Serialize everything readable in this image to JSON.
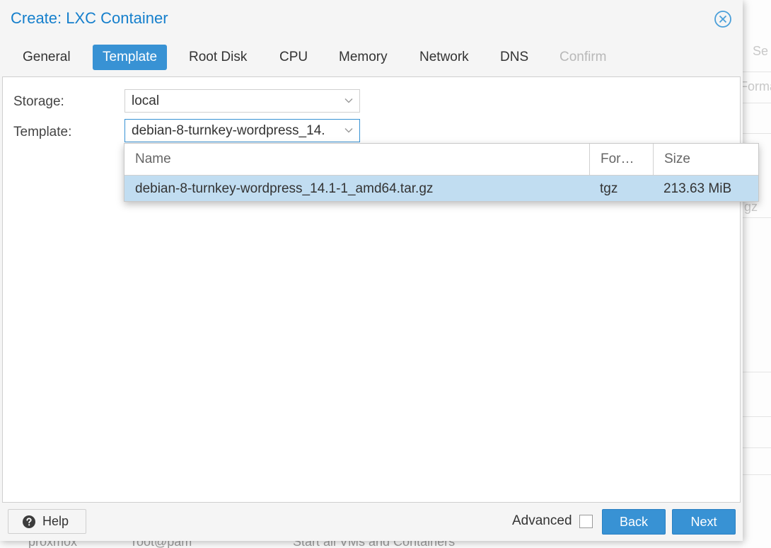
{
  "background": {
    "fragments": [
      "Se",
      "Forma",
      "gz"
    ],
    "bottom": [
      "proxmox",
      "root@pam",
      "Start all VMs and Containers"
    ]
  },
  "dialog": {
    "title": "Create: LXC Container",
    "tabs": [
      {
        "label": "General",
        "state": "normal"
      },
      {
        "label": "Template",
        "state": "active"
      },
      {
        "label": "Root Disk",
        "state": "normal"
      },
      {
        "label": "CPU",
        "state": "normal"
      },
      {
        "label": "Memory",
        "state": "normal"
      },
      {
        "label": "Network",
        "state": "normal"
      },
      {
        "label": "DNS",
        "state": "normal"
      },
      {
        "label": "Confirm",
        "state": "disabled"
      }
    ],
    "form": {
      "storage": {
        "label": "Storage:",
        "value": "local"
      },
      "template": {
        "label": "Template:",
        "value": "debian-8-turnkey-wordpress_14."
      }
    },
    "dropdown": {
      "columns": [
        "Name",
        "For…",
        "Size"
      ],
      "rows": [
        {
          "name": "debian-8-turnkey-wordpress_14.1-1_amd64.tar.gz",
          "format": "tgz",
          "size": "213.63 MiB"
        }
      ]
    },
    "footer": {
      "help_label": "Help",
      "advanced_label": "Advanced",
      "back_label": "Back",
      "next_label": "Next"
    }
  },
  "colors": {
    "accent": "#3892d4",
    "title": "#157fcc",
    "selected_row": "#c1ddf1"
  }
}
